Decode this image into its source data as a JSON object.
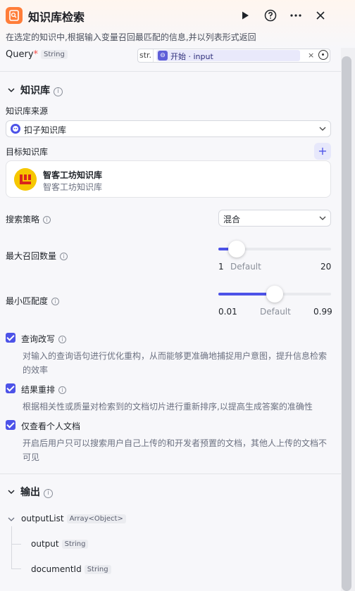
{
  "header": {
    "title": "知识库检索",
    "description": "在选定的知识中,根据输入变量召回最匹配的信息,并以列表形式返回",
    "icons": [
      "run-icon",
      "help-icon",
      "more-icon",
      "close-icon"
    ],
    "accent": "#ff7d39"
  },
  "query": {
    "label": "Query",
    "required_mark": "*",
    "type": "String",
    "prefix": "str.",
    "value": "开始 · input",
    "clear": "×"
  },
  "knowledge": {
    "section_title": "知识库",
    "source_label": "知识库来源",
    "source_value": "扣子知识库",
    "target_label": "目标知识库",
    "add_symbol": "+",
    "item": {
      "name": "智客工坊知识库",
      "subtitle": "智客工坊知识库"
    },
    "strategy_label": "搜索策略",
    "strategy_value": "混合",
    "max_recall": {
      "label": "最大召回数量",
      "min": "1",
      "mid": "Default",
      "max": "20",
      "value_fraction": 0.16
    },
    "min_match": {
      "label": "最小匹配度",
      "min": "0.01",
      "mid": "Default",
      "max": "0.99",
      "value_fraction": 0.5
    },
    "options": [
      {
        "label": "查询改写",
        "checked": true,
        "desc_line1": "对输入的查询语句进行优化重构，从而能够更准确地捕捉用户意图，提升信息检索",
        "desc_line2": "的效率"
      },
      {
        "label": "结果重排",
        "checked": true,
        "desc_line1": "根据相关性或质量对检索到的文档切片进行重新排序,以提高生成答案的准确性",
        "desc_line2": ""
      },
      {
        "label": "仅查看个人文档",
        "checked": true,
        "desc_line1": "开启后用户只可以搜索用户自己上传的和开发者预置的文档，其他人上传的文档不",
        "desc_line2": "可见"
      }
    ]
  },
  "output": {
    "section_title": "输出",
    "root": {
      "name": "outputList",
      "type": "Array<Object>"
    },
    "children": [
      {
        "name": "output",
        "type": "String"
      },
      {
        "name": "documentId",
        "type": "String"
      }
    ]
  },
  "colors": {
    "primary": "#4d53e8",
    "chip_bg": "#e9e9fb"
  }
}
